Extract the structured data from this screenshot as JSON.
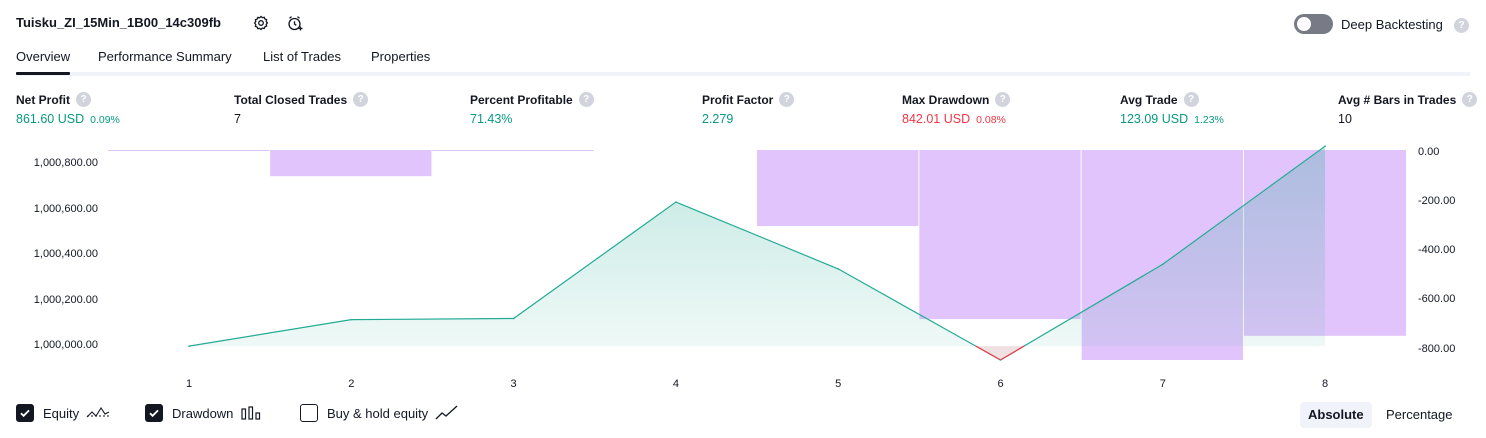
{
  "header": {
    "strategy_name": "Tuisku_ZI_15Min_1B00_14c309fb",
    "deep_backtesting_label": "Deep Backtesting",
    "deep_backtesting_on": false,
    "help_glyph": "?"
  },
  "tabs": [
    {
      "label": "Overview",
      "active": true
    },
    {
      "label": "Performance Summary",
      "active": false
    },
    {
      "label": "List of Trades",
      "active": false
    },
    {
      "label": "Properties",
      "active": false
    }
  ],
  "stats": [
    {
      "label": "Net Profit",
      "value": "861.60 USD",
      "pct": "0.09%",
      "color": "green"
    },
    {
      "label": "Total Closed Trades",
      "value": "7",
      "pct": "",
      "color": "dark"
    },
    {
      "label": "Percent Profitable",
      "value": "71.43%",
      "pct": "",
      "color": "green"
    },
    {
      "label": "Profit Factor",
      "value": "2.279",
      "pct": "",
      "color": "green"
    },
    {
      "label": "Max Drawdown",
      "value": "842.01 USD",
      "pct": "0.08%",
      "color": "red"
    },
    {
      "label": "Avg Trade",
      "value": "123.09 USD",
      "pct": "1.23%",
      "color": "green"
    },
    {
      "label": "Avg # Bars in Trades",
      "value": "10",
      "pct": "",
      "color": "dark"
    }
  ],
  "chart_data": {
    "type": "line",
    "x": [
      1,
      2,
      3,
      4,
      5,
      6,
      7,
      8
    ],
    "xticks": [
      "1",
      "2",
      "3",
      "4",
      "5",
      "6",
      "7",
      "8"
    ],
    "left_axis": {
      "ticks": [
        "1,000,800.00",
        "1,000,600.00",
        "1,000,400.00",
        "1,000,200.00",
        "1,000,000.00"
      ],
      "ylim": [
        999980,
        1000860
      ]
    },
    "right_axis": {
      "ticks": [
        "0.00",
        "-200.00",
        "-400.00",
        "-600.00",
        "-800.00"
      ],
      "ylim": [
        -842,
        0
      ]
    },
    "series": [
      {
        "name": "Equity",
        "axis": "left",
        "values": [
          999995,
          1000110,
          1000115,
          1000620,
          1000330,
          999935,
          1000350,
          1000862
        ]
      },
      {
        "name": "Drawdown",
        "axis": "right",
        "type": "bar",
        "values": [
          -3,
          -105,
          -3,
          0,
          -305,
          -678,
          -842,
          -745
        ]
      }
    ],
    "colors": {
      "equity_line": "#22ab94",
      "equity_fill": "#22ab94",
      "equity_below": "#f23645",
      "drawdown_bar": "#e1c4fb"
    }
  },
  "legend": {
    "items": [
      {
        "label": "Equity",
        "checked": true,
        "icon": "equity-line-icon"
      },
      {
        "label": "Drawdown",
        "checked": true,
        "icon": "drawdown-bars-icon"
      },
      {
        "label": "Buy & hold equity",
        "checked": false,
        "icon": "buy-hold-line-icon"
      }
    ],
    "modes": [
      {
        "label": "Absolute",
        "active": true
      },
      {
        "label": "Percentage",
        "active": false
      }
    ]
  }
}
